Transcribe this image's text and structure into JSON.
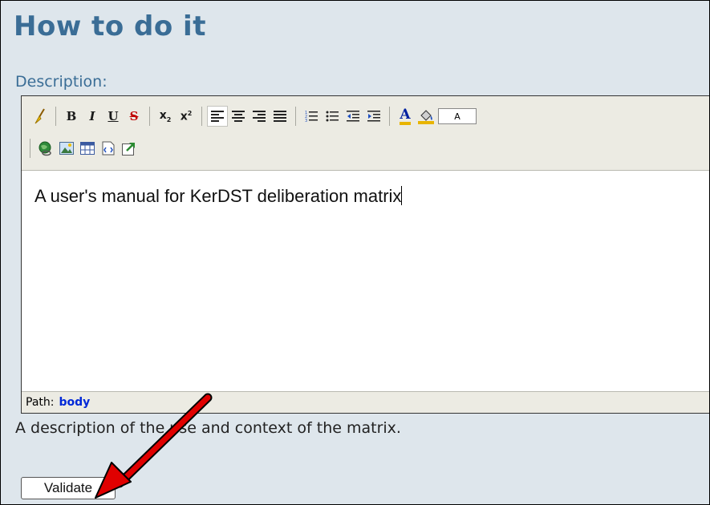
{
  "page": {
    "title": "How to do it"
  },
  "field": {
    "label": "Description:",
    "help_text": "A description of the use and context of the matrix."
  },
  "toolbar": {
    "row1": [
      {
        "name": "cleanup-icon",
        "glyph": "🖌"
      },
      {
        "name": "bold-button",
        "glyph": "B"
      },
      {
        "name": "italic-button",
        "glyph": "I"
      },
      {
        "name": "underline-button",
        "glyph": "U"
      },
      {
        "name": "strikethrough-button",
        "glyph": "S"
      },
      {
        "name": "subscript-button",
        "glyph": "x₂"
      },
      {
        "name": "superscript-button",
        "glyph": "x²"
      },
      {
        "name": "align-left-button",
        "glyph": "align-left"
      },
      {
        "name": "align-center-button",
        "glyph": "align-center"
      },
      {
        "name": "align-right-button",
        "glyph": "align-right"
      },
      {
        "name": "align-justify-button",
        "glyph": "align-justify"
      },
      {
        "name": "ordered-list-button",
        "glyph": "ordered-list"
      },
      {
        "name": "unordered-list-button",
        "glyph": "unordered-list"
      },
      {
        "name": "outdent-button",
        "glyph": "outdent"
      },
      {
        "name": "indent-button",
        "glyph": "indent"
      },
      {
        "name": "font-color-button",
        "glyph": "A"
      },
      {
        "name": "background-color-button",
        "glyph": "paint-bucket"
      }
    ],
    "style_box": "A",
    "row2": [
      {
        "name": "link-icon",
        "glyph": "globe-link"
      },
      {
        "name": "image-icon",
        "glyph": "image"
      },
      {
        "name": "table-icon",
        "glyph": "table"
      },
      {
        "name": "html-source-icon",
        "glyph": "html-source"
      },
      {
        "name": "fullscreen-icon",
        "glyph": "fullscreen"
      }
    ]
  },
  "editor": {
    "content": "A user's manual for KerDST deliberation matrix"
  },
  "pathbar": {
    "label": "Path:",
    "value": "body"
  },
  "actions": {
    "validate_label": "Validate"
  },
  "colors": {
    "title": "#3a6d96",
    "background": "#dee6ec",
    "arrow": "#e00000",
    "path_value": "#0028d8"
  }
}
